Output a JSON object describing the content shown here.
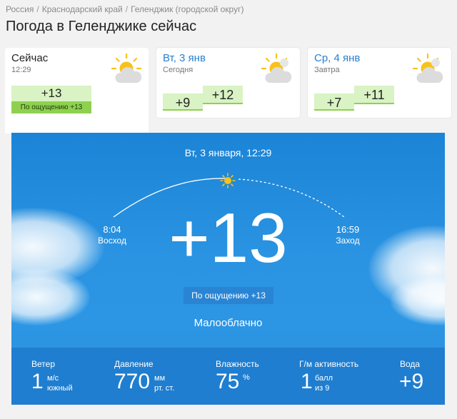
{
  "breadcrumb": {
    "items": [
      "Россия",
      "Краснодарский край",
      "Геленджик (городской округ)"
    ],
    "separator": "/"
  },
  "page_title": "Погода в Геленджике сейчас",
  "now_card": {
    "title": "Сейчас",
    "time": "12:29",
    "icon": "sun-behind-cloud-icon",
    "temp": "+13",
    "feels_like": "По ощущению +13"
  },
  "day_cards": [
    {
      "title": "Вт, 3 янв",
      "subtitle": "Сегодня",
      "icon": "sun-behind-cloud-icon",
      "temp_low": "+9",
      "temp_high": "+12"
    },
    {
      "title": "Ср, 4 янв",
      "subtitle": "Завтра",
      "icon": "sun-behind-cloud-icon",
      "temp_low": "+7",
      "temp_high": "+11"
    }
  ],
  "hero": {
    "datetime": "Вт, 3 января, 12:29",
    "sunrise_time": "8:04",
    "sunrise_label": "Восход",
    "sunset_time": "16:59",
    "sunset_label": "Заход",
    "temp": "+13",
    "feels_like": "По ощущению +13",
    "condition": "Малооблачно"
  },
  "stats": {
    "wind": {
      "label": "Ветер",
      "value": "1",
      "unit_top": "м/с",
      "unit_bottom": "южный"
    },
    "pressure": {
      "label": "Давление",
      "value": "770",
      "unit_top": "мм",
      "unit_bottom": "рт. ст."
    },
    "humidity": {
      "label": "Влажность",
      "value": "75",
      "unit_top": "%"
    },
    "geomagnetic": {
      "label": "Г/м активность",
      "value": "1",
      "unit_top": "балл",
      "unit_bottom": "из 9"
    },
    "water": {
      "label": "Вода",
      "value": "+9"
    }
  },
  "colors": {
    "accent_link": "#2a7fd0",
    "temp_bg": "#d9f3c4",
    "temp_bar": "#8fd14f",
    "sky": "#2a93e2",
    "stats_bar": "#1f7ed0",
    "sun": "#f7c21b"
  }
}
